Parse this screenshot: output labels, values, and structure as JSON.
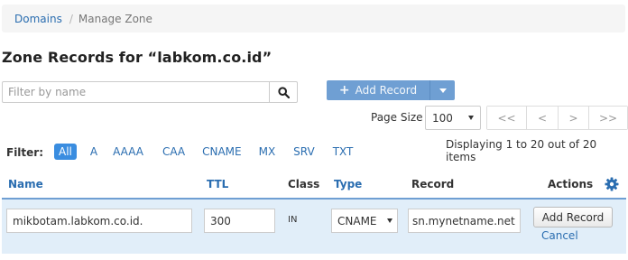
{
  "breadcrumb": {
    "domains": "Domains",
    "separator": "/",
    "current": "Manage Zone"
  },
  "title": "Zone Records for “labkom.co.id”",
  "filter": {
    "placeholder": "Filter by name",
    "value": ""
  },
  "icons": {
    "search": "search-icon",
    "plus": "plus-icon",
    "caret": "caret-down-icon",
    "gear": "gear-icon"
  },
  "add_record": {
    "label": "Add Record"
  },
  "page_size": {
    "label": "Page Size",
    "value": "100"
  },
  "pager": {
    "first": "<<",
    "prev": "<",
    "next": ">",
    "last": ">>"
  },
  "type_filter": {
    "label": "Filter:",
    "tabs": [
      "All",
      "A",
      "AAAA",
      "CAA",
      "CNAME",
      "MX",
      "SRV",
      "TXT"
    ],
    "active": "All"
  },
  "display_info": "Displaying 1 to 20 out of 20 items",
  "columns": {
    "name": "Name",
    "ttl": "TTL",
    "class": "Class",
    "type": "Type",
    "record": "Record",
    "actions": "Actions"
  },
  "edit_row": {
    "name": "mikbotam.labkom.co.id.",
    "ttl": "300",
    "class": "IN",
    "type": "CNAME",
    "record": "sn.mynetname.net",
    "add_label": "Add Record",
    "cancel_label": "Cancel"
  },
  "colors": {
    "accent": "#2a6db0",
    "button": "#6f9fd3",
    "active_tab": "#3a8de0",
    "edit_row_bg": "#e1eef9"
  }
}
